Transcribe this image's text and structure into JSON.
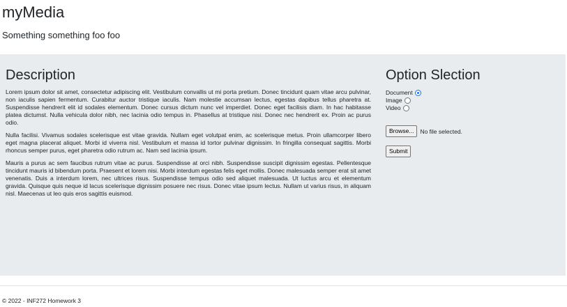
{
  "header": {
    "title": "myMedia",
    "tagline": "Something something foo foo"
  },
  "description": {
    "heading": "Description",
    "paragraphs": [
      "Lorem ipsum dolor sit amet, consectetur adipiscing elit. Vestibulum convallis ut mi porta pretium. Donec tincidunt quam vitae arcu pulvinar, non iaculis sapien fermentum. Curabitur auctor tristique iaculis. Nam molestie accumsan lectus, egestas dapibus tellus pharetra at. Suspendisse hendrerit elit id sodales elementum. Donec cursus dictum nunc vel imperdiet. Donec eget facilisis diam. In hac habitasse platea dictumst. Nulla vehicula dolor nibh, nec lacinia odio tempus in. Phasellus at tristique nisi. Donec nec hendrerit ex. Proin ac purus odio.",
      "Nulla facilisi. Vivamus sodales scelerisque est vitae gravida. Nullam eget volutpat enim, ac scelerisque metus. Proin ullamcorper libero eget magna placerat aliquet. Morbi id viverra nisl. Vestibulum et massa id tortor pulvinar dignissim. In fringilla consequat sagittis. Morbi rhoncus semper purus, eget pharetra odio rutrum ac. Nam sed lacinia ipsum.",
      "Mauris a purus ac sem faucibus rutrum vitae ac purus. Suspendisse at orci nibh. Suspendisse suscipit dignissim egestas. Pellentesque tincidunt mauris id bibendum porta. Praesent et lorem nisi. Morbi interdum egestas felis eget mollis. Donec malesuada semper erat sit amet venenatis. Duis a interdum lorem, nec ultrices risus. Suspendisse tempus odio sed aliquet malesuada. Ut luctus arcu et elementum gravida. Quisque quis neque id lacus scelerisque dignissim posuere nec risus. Donec vitae ipsum lectus. Nullam ut varius risus, in aliquam nisl. Maecenas ut leo quis eros sagittis euismod."
    ]
  },
  "options": {
    "heading": "Option Slection",
    "radios": [
      {
        "label": "Document",
        "checked": true
      },
      {
        "label": "Image",
        "checked": false
      },
      {
        "label": "Video",
        "checked": false
      }
    ],
    "browse_label": "Browse...",
    "file_status": "No file selected.",
    "submit_label": "Submit"
  },
  "footer": {
    "text": "© 2022 - INF272 Homework 3"
  },
  "colors": {
    "panel_bg": "#e9ecef",
    "accent": "#0d6efd"
  }
}
